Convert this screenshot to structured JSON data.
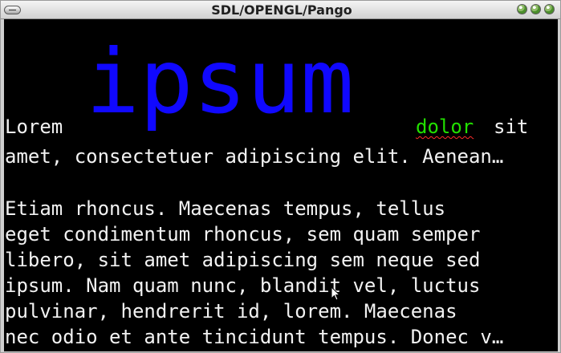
{
  "window": {
    "title": "SDL/OPENGL/Pango",
    "controls": [
      "window-control",
      "window-control",
      "window-control"
    ]
  },
  "content": {
    "first_line": {
      "lorem": "Lorem",
      "ipsum": "ipsum",
      "dolor": "dolor",
      "sit": "sit"
    },
    "lines": [
      "amet, consectetuer adipiscing elit. Aenean…",
      "Etiam rhoncus. Maecenas tempus, tellus",
      "eget condimentum rhoncus, sem quam semper",
      "libero, sit amet adipiscing sem neque sed",
      "ipsum. Nam quam nunc, blandit vel, luctus",
      "pulvinar, hendrerit id, lorem. Maecenas",
      "nec odio et ante tincidunt tempus. Donec v…"
    ],
    "colors": {
      "background": "#000000",
      "text": "#f2f2f2",
      "ipsum": "#1008ff",
      "dolor": "#22e000",
      "spellcheck": "#ff2b2b"
    }
  },
  "cursor": {
    "icon": "mouse-pointer-icon"
  }
}
